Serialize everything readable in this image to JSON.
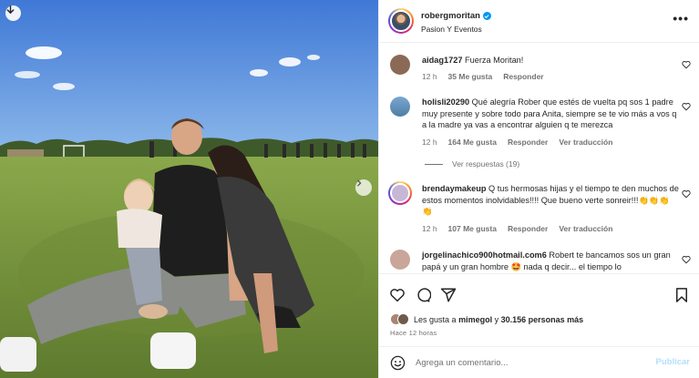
{
  "post": {
    "username": "robergmoritan",
    "subtitle": "Pasion Y Eventos",
    "more_icon": "more-horizontal-icon",
    "verified_icon": "verified-badge-icon"
  },
  "comments": [
    {
      "username": "aidag1727",
      "text": "Fuerza Moritan!",
      "time": "12 h",
      "likes": "35 Me gusta",
      "reply": "Responder",
      "avatar_color": "#8a6a55"
    },
    {
      "username": "holisli20290",
      "text": "Qué alegría Rober que estés de vuelta pq sos 1 padre muy presente y sobre todo para Anita, siempre se te vio más a vos q a la madre ya vas a encontrar alguien q te merezca",
      "time": "12 h",
      "likes": "164 Me gusta",
      "reply": "Responder",
      "translate": "Ver traducción",
      "view_replies": "Ver respuestas (19)",
      "avatar_color": "#5d8fb8"
    },
    {
      "username": "brendaymakeup",
      "text": "Q tus hermosas hijas y el tiempo te den muchos de estos momentos inolvidables!!!! Que bueno verte sonreir!!!👏👏👏👏",
      "time": "12 h",
      "likes": "107 Me gusta",
      "reply": "Responder",
      "translate": "Ver traducción",
      "avatar_color": "#c7b6d6"
    },
    {
      "username": "jorgelinachico900hotmail.com6",
      "text": "Robert te bancamos sos un gran papá y un gran hombre 🤩 nada q decir... el tiempo lo",
      "avatar_color": "#c9a59a"
    }
  ],
  "actions": {
    "like_icon": "heart-icon",
    "comment_icon": "comment-icon",
    "share_icon": "share-icon",
    "save_icon": "bookmark-icon"
  },
  "likes_summary": {
    "prefix": "Les gusta a",
    "user": "mimegol",
    "connector": "y",
    "count": "30.156 personas más"
  },
  "time_ago": "Hace 12 horas",
  "add_comment": {
    "placeholder": "Agrega un comentario...",
    "publish_label": "Publicar"
  },
  "colors": {
    "accent": "#0095f6",
    "publish_disabled": "#b2dffc",
    "muted": "#737373"
  }
}
